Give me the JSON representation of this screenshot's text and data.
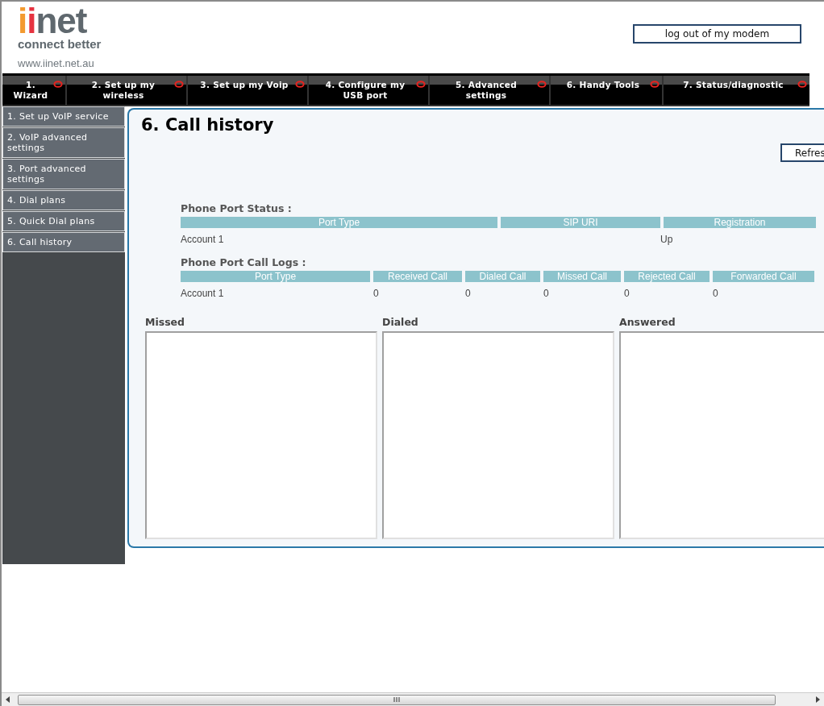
{
  "logo": {
    "parts": [
      {
        "text": "i",
        "color": "#f39a30"
      },
      {
        "text": "i",
        "color": "#e63340"
      },
      {
        "text": "net",
        "color": "#5f686e"
      }
    ],
    "tagline": "connect better",
    "url": "www.iinet.net.au"
  },
  "logout_button": "log out of my modem",
  "nav": [
    {
      "label": "1. Wizard"
    },
    {
      "label": "2. Set up my wireless"
    },
    {
      "label": "3. Set up my Voip"
    },
    {
      "label": "4. Configure my USB port"
    },
    {
      "label": "5. Advanced settings"
    },
    {
      "label": "6. Handy Tools"
    },
    {
      "label": "7. Status/diagnostic"
    }
  ],
  "sidebar": {
    "items": [
      {
        "label": "1. Set up VoIP service"
      },
      {
        "label": "2. VoIP advanced settings"
      },
      {
        "label": "3. Port advanced settings"
      },
      {
        "label": "4. Dial plans"
      },
      {
        "label": "5. Quick Dial plans"
      },
      {
        "label": "6. Call history"
      }
    ]
  },
  "page": {
    "title": "6. Call history",
    "refresh_button": "Refres",
    "status": {
      "heading": "Phone Port Status :",
      "columns": [
        "Port Type",
        "SIP URI",
        "Registration"
      ],
      "rows": [
        {
          "port_type": "Account 1",
          "registration": "Up"
        }
      ]
    },
    "call_logs": {
      "heading": "Phone Port Call Logs :",
      "columns": [
        "Port Type",
        "Received Call",
        "Dialed Call",
        "Missed Call",
        "Rejected Call",
        "Forwarded Call"
      ],
      "rows": [
        [
          "Account 1",
          "0",
          "0",
          "0",
          "0",
          "0"
        ]
      ]
    },
    "lists": [
      {
        "label": "Missed"
      },
      {
        "label": "Dialed"
      },
      {
        "label": "Answered"
      }
    ]
  }
}
